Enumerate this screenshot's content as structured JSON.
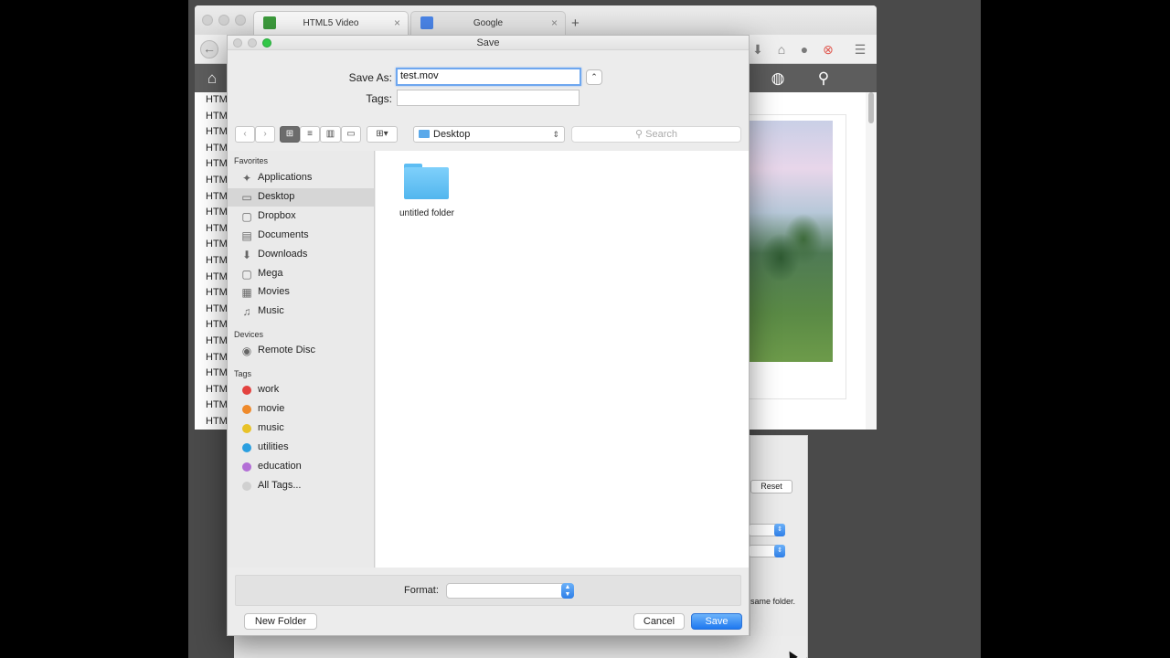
{
  "browser": {
    "tabs": [
      {
        "label": "HTML5 Video",
        "close": "×"
      },
      {
        "label": "Google",
        "close": "×"
      }
    ],
    "new_tab": "+",
    "list_item": "HTM",
    "list_count": 21
  },
  "settings_panel": {
    "reset_label": "Reset",
    "note_text": "same folder."
  },
  "dialog": {
    "title": "Save",
    "save_as_label": "Save As:",
    "save_as_value": "test.mov",
    "tags_label": "Tags:",
    "tags_value": "",
    "expand_glyph": "⌃",
    "nav_back": "‹",
    "nav_forward": "›",
    "arrange_glyph": "▾",
    "location": "Desktop",
    "location_chevron": "⇕",
    "search_placeholder": "Search",
    "search_icon": "magnifier-icon",
    "sidebar": {
      "favorites_heading": "Favorites",
      "favorites": [
        {
          "label": "Applications",
          "icon": "applications-icon"
        },
        {
          "label": "Desktop",
          "icon": "desktop-icon",
          "selected": true
        },
        {
          "label": "Dropbox",
          "icon": "folder-icon"
        },
        {
          "label": "Documents",
          "icon": "documents-icon"
        },
        {
          "label": "Downloads",
          "icon": "downloads-icon"
        },
        {
          "label": "Mega",
          "icon": "folder-icon"
        },
        {
          "label": "Movies",
          "icon": "movies-icon"
        },
        {
          "label": "Music",
          "icon": "music-icon"
        }
      ],
      "devices_heading": "Devices",
      "devices": [
        {
          "label": "Remote Disc",
          "icon": "disc-icon"
        }
      ],
      "tags_heading": "Tags",
      "tags": [
        {
          "label": "work",
          "color": "#e3423f"
        },
        {
          "label": "movie",
          "color": "#ef8a2b"
        },
        {
          "label": "music",
          "color": "#e8c228"
        },
        {
          "label": "utilities",
          "color": "#2a9fe0"
        },
        {
          "label": "education",
          "color": "#b36fd6"
        },
        {
          "label": "All Tags...",
          "color": "#d0d0d0"
        }
      ]
    },
    "files": [
      {
        "name": "untitled folder",
        "type": "folder"
      }
    ],
    "format_label": "Format:",
    "format_value": "",
    "new_folder_label": "New Folder",
    "cancel_label": "Cancel",
    "save_label": "Save"
  },
  "colors": {
    "accent": "#2e7fe8",
    "folder": "#5dbdf3",
    "selection": "#d6d6d6"
  }
}
